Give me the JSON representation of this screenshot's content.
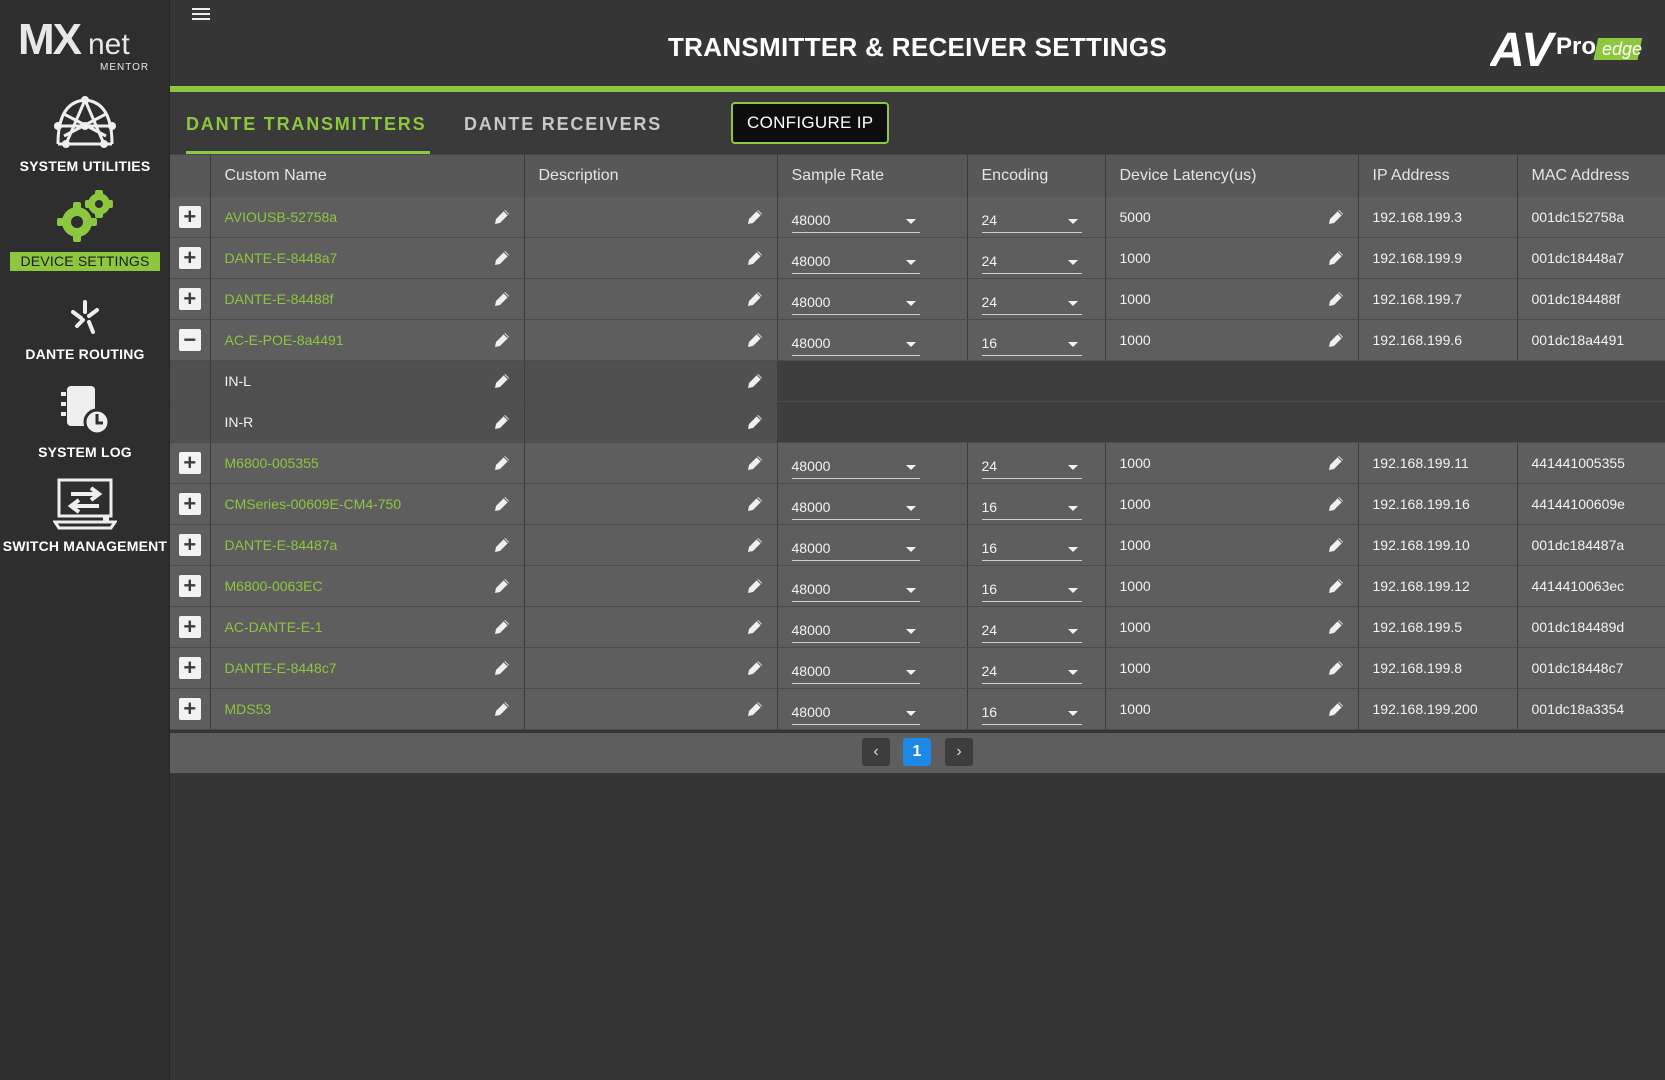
{
  "brand": {
    "mx": "MX",
    "net": "net",
    "sub": "MENTOR"
  },
  "av_brand": {
    "av": "AV",
    "pro": "Pro",
    "edge": "edge"
  },
  "sidebar": {
    "items": [
      {
        "label": "SYSTEM UTILITIES",
        "icon": "dome-network-icon"
      },
      {
        "label": "DEVICE SETTINGS",
        "icon": "gears-icon",
        "active": true
      },
      {
        "label": "DANTE ROUTING",
        "icon": "dante-routing-icon"
      },
      {
        "label": "SYSTEM LOG",
        "icon": "log-clock-icon"
      },
      {
        "label": "SWITCH MANAGEMENT",
        "icon": "switch-icon"
      }
    ]
  },
  "header": {
    "title": "TRANSMITTER & RECEIVER SETTINGS"
  },
  "tabs": {
    "transmitters": "DANTE TRANSMITTERS",
    "receivers": "DANTE RECEIVERS",
    "configure_ip": "CONFIGURE IP"
  },
  "columns": [
    "Custom Name",
    "Description",
    "Sample Rate",
    "Encoding",
    "Device Latency(us)",
    "IP Address",
    "MAC Address"
  ],
  "rows": [
    {
      "kind": "device",
      "toggle": "+",
      "name": "AVIOUSB-52758a",
      "desc": "",
      "rate": "48000",
      "enc": "24",
      "latency": "5000",
      "ip": "192.168.199.3",
      "mac": "001dc152758a"
    },
    {
      "kind": "device",
      "toggle": "+",
      "name": "DANTE-E-8448a7",
      "desc": "",
      "rate": "48000",
      "enc": "24",
      "latency": "1000",
      "ip": "192.168.199.9",
      "mac": "001dc18448a7"
    },
    {
      "kind": "device",
      "toggle": "+",
      "name": "DANTE-E-84488f",
      "desc": "",
      "rate": "48000",
      "enc": "24",
      "latency": "1000",
      "ip": "192.168.199.7",
      "mac": "001dc184488f"
    },
    {
      "kind": "device",
      "toggle": "−",
      "name": "AC-E-POE-8a4491",
      "desc": "",
      "rate": "48000",
      "enc": "16",
      "latency": "1000",
      "ip": "192.168.199.6",
      "mac": "001dc18a4491"
    },
    {
      "kind": "channel",
      "name": "IN-L",
      "desc": ""
    },
    {
      "kind": "channel",
      "name": "IN-R",
      "desc": ""
    },
    {
      "kind": "device",
      "toggle": "+",
      "name": "M6800-005355",
      "desc": "",
      "rate": "48000",
      "enc": "24",
      "latency": "1000",
      "ip": "192.168.199.11",
      "mac": "441441005355"
    },
    {
      "kind": "device",
      "toggle": "+",
      "name": "CMSeries-00609E-CM4-750",
      "desc": "",
      "rate": "48000",
      "enc": "16",
      "latency": "1000",
      "ip": "192.168.199.16",
      "mac": "44144100609e"
    },
    {
      "kind": "device",
      "toggle": "+",
      "name": "DANTE-E-84487a",
      "desc": "",
      "rate": "48000",
      "enc": "16",
      "latency": "1000",
      "ip": "192.168.199.10",
      "mac": "001dc184487a"
    },
    {
      "kind": "device",
      "toggle": "+",
      "name": "M6800-0063EC",
      "desc": "",
      "rate": "48000",
      "enc": "16",
      "latency": "1000",
      "ip": "192.168.199.12",
      "mac": "4414410063ec"
    },
    {
      "kind": "device",
      "toggle": "+",
      "name": "AC-DANTE-E-1",
      "desc": "",
      "rate": "48000",
      "enc": "24",
      "latency": "1000",
      "ip": "192.168.199.5",
      "mac": "001dc184489d"
    },
    {
      "kind": "device",
      "toggle": "+",
      "name": "DANTE-E-8448c7",
      "desc": "",
      "rate": "48000",
      "enc": "24",
      "latency": "1000",
      "ip": "192.168.199.8",
      "mac": "001dc18448c7"
    },
    {
      "kind": "device",
      "toggle": "+",
      "name": "MDS53",
      "desc": "",
      "rate": "48000",
      "enc": "16",
      "latency": "1000",
      "ip": "192.168.199.200",
      "mac": "001dc18a3354"
    }
  ],
  "pagination": {
    "prev": "‹",
    "current": "1",
    "next": "›"
  }
}
